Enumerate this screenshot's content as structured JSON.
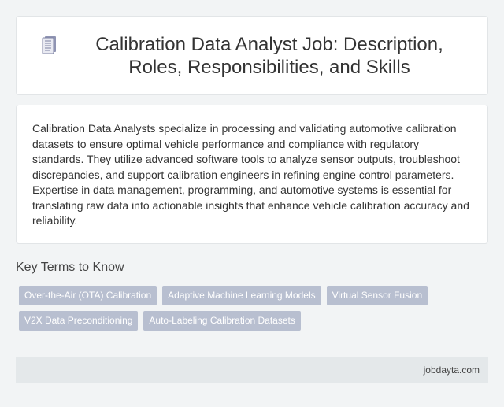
{
  "header": {
    "icon": "document-icon",
    "title": "Calibration Data Analyst Job: Description, Roles, Responsibilities, and Skills"
  },
  "description": {
    "text": "Calibration Data Analysts specialize in processing and validating automotive calibration datasets to ensure optimal vehicle performance and compliance with regulatory standards. They utilize advanced software tools to analyze sensor outputs, troubleshoot discrepancies, and support calibration engineers in refining engine control parameters. Expertise in data management, programming, and automotive systems is essential for translating raw data into actionable insights that enhance vehicle calibration accuracy and reliability."
  },
  "key_terms": {
    "heading": "Key Terms to Know",
    "tags": [
      "Over-the-Air (OTA) Calibration",
      "Adaptive Machine Learning Models",
      "Virtual Sensor Fusion",
      "V2X Data Preconditioning",
      "Auto-Labeling Calibration Datasets"
    ]
  },
  "footer": {
    "site": "jobdayta.com"
  },
  "colors": {
    "background": "#f2f4f5",
    "tag_bg": "#b8bfd0",
    "footer_bg": "#e4e8ea"
  }
}
